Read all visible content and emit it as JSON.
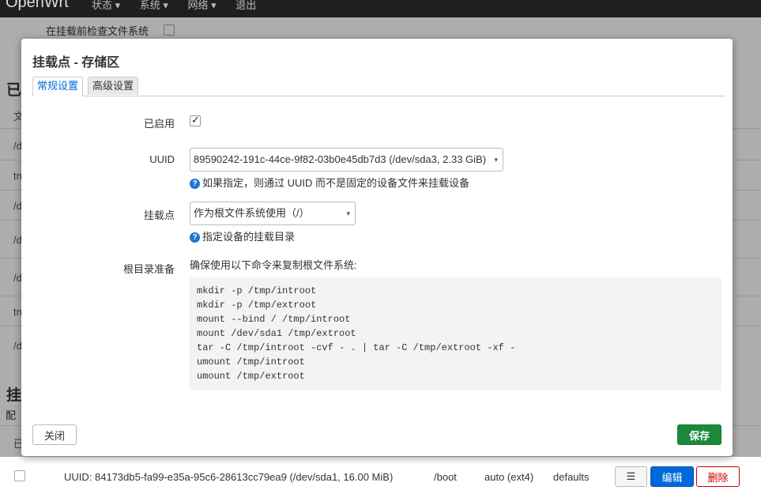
{
  "navbar": {
    "brand": "OpenWrt",
    "menu": [
      "状态 ▾",
      "系统 ▾",
      "网络 ▾",
      "退出"
    ]
  },
  "background": {
    "check_fs_label": "在挂载前检查文件系统",
    "heading_1": "已",
    "heading_2": "挂",
    "config_text": "配",
    "table_header_text": "文",
    "row_fragments": [
      "/d",
      "tn",
      "/d",
      "/d",
      "/d",
      "tn",
      "/d"
    ],
    "bottom_header_text": "已",
    "bottom_row": {
      "uuid_text": "UUID: 84173db5-fa99-e35a-95c6-28613cc79ea9 (/dev/sda1, 16.00 MiB)",
      "mountpoint": "/boot",
      "fstype": "auto (ext4)",
      "options": "defaults",
      "menu_label": "☰",
      "edit_label": "编辑",
      "delete_label": "删除"
    }
  },
  "modal": {
    "title": "挂载点 - 存储区",
    "tabs": [
      {
        "label": "常规设置",
        "active": true
      },
      {
        "label": "高级设置",
        "active": false
      }
    ],
    "enabled": {
      "label": "已启用",
      "checked": true,
      "check_glyph": "✓"
    },
    "uuid": {
      "label": "UUID",
      "value": "89590242-191c-44ce-9f82-03b0e45db7d3 (/dev/sda3, 2.33 GiB)",
      "help": "如果指定，则通过 UUID 而不是固定的设备文件来挂载设备"
    },
    "mountpoint": {
      "label": "挂载点",
      "value": "作为根文件系统使用（/）",
      "help": "指定设备的挂载目录"
    },
    "rootprep": {
      "label": "根目录准备",
      "description": "确保使用以下命令来复制根文件系统:",
      "commands": [
        "mkdir -p /tmp/introot",
        "mkdir -p /tmp/extroot",
        "mount --bind / /tmp/introot",
        "mount /dev/sda1 /tmp/extroot",
        "tar -C /tmp/introot -cvf - . | tar -C /tmp/extroot -xf -",
        "umount /tmp/introot",
        "umount /tmp/extroot"
      ]
    },
    "close_label": "关闭",
    "save_label": "保存",
    "help_icon_glyph": "?",
    "caret_glyph": "▾"
  },
  "colors": {
    "accent": "#0069d9",
    "save": "#1a8a3a",
    "help_icon": "#1976d2",
    "navbar": "#1f1f1f"
  }
}
